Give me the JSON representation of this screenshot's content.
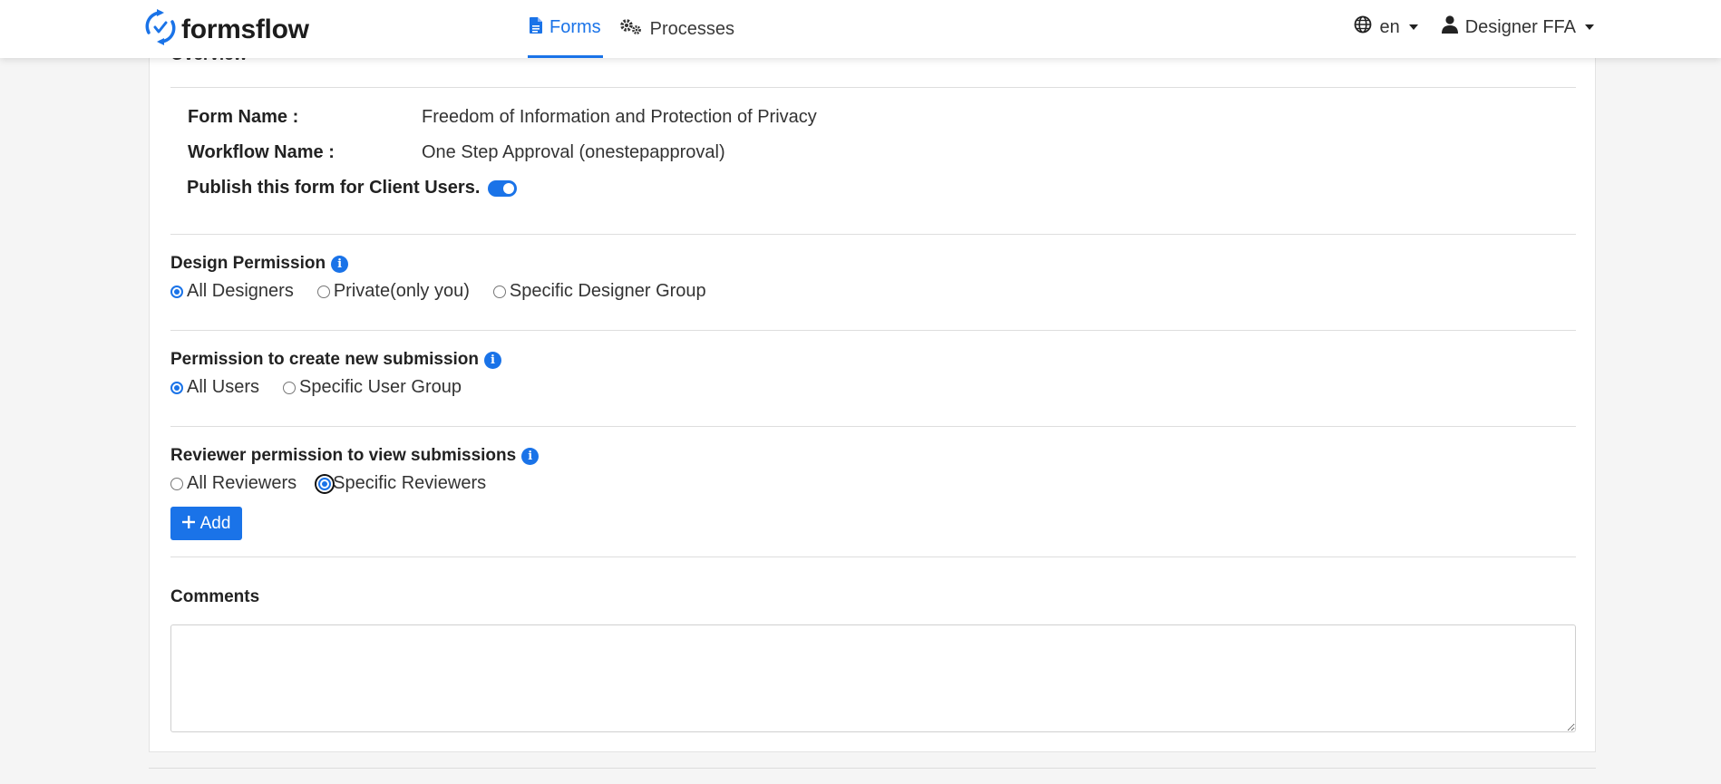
{
  "header": {
    "brand": "formsflow",
    "nav": [
      {
        "label": "Forms",
        "icon": "document-icon",
        "active": true
      },
      {
        "label": "Processes",
        "icon": "gears-icon",
        "active": false
      }
    ],
    "language": "en",
    "user": "Designer FFA",
    "accent_color": "#1a73e8"
  },
  "overview": {
    "title": "Overview",
    "form_name_label": "Form Name :",
    "form_name_value": "Freedom of Information and Protection of Privacy",
    "workflow_name_label": "Workflow Name :",
    "workflow_name_value": "One Step Approval (onestepapproval)",
    "publish_label": "Publish this form for Client Users.",
    "publish_enabled": true
  },
  "design_permission": {
    "title": "Design Permission",
    "options": [
      "All Designers",
      "Private(only you)",
      "Specific Designer Group"
    ],
    "selected": "All Designers"
  },
  "submission_permission": {
    "title": "Permission to create new submission",
    "options": [
      "All Users",
      "Specific User Group"
    ],
    "selected": "All Users"
  },
  "reviewer_permission": {
    "title": "Reviewer permission to view submissions",
    "options": [
      "All Reviewers",
      "Specific Reviewers"
    ],
    "selected": "Specific Reviewers",
    "add_button": "Add"
  },
  "comments": {
    "label": "Comments",
    "value": ""
  }
}
